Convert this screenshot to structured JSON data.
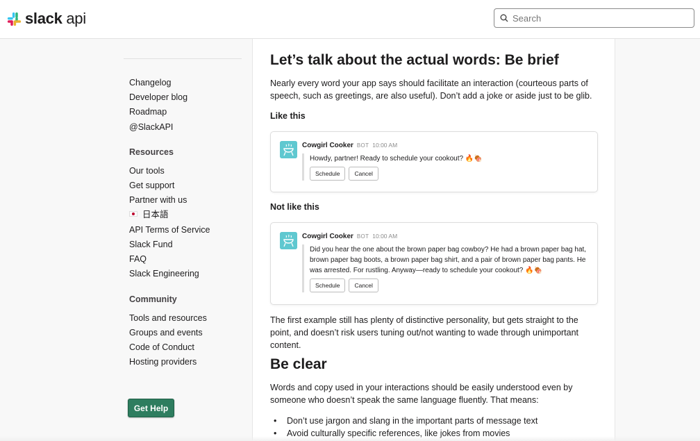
{
  "header": {
    "logo_bold": "slack",
    "logo_light": " api",
    "search_placeholder": "Search"
  },
  "sidebar": {
    "links_top": [
      "Changelog",
      "Developer blog",
      "Roadmap",
      "@SlackAPI"
    ],
    "resources_heading": "Resources",
    "resources": [
      "Our tools",
      "Get support",
      "Partner with us",
      "日本語",
      "API Terms of Service",
      "Slack Fund",
      "FAQ",
      "Slack Engineering"
    ],
    "community_heading": "Community",
    "community": [
      "Tools and resources",
      "Groups and events",
      "Code of Conduct",
      "Hosting providers"
    ],
    "get_help": "Get Help"
  },
  "main": {
    "heading1": "Let’s talk about the actual words: Be brief",
    "para1": "Nearly every word your app says should facilitate an interaction (courteous parts of speech, such as greetings, are also useful). Don’t add a joke or aside just to be glib.",
    "like_label": "Like this",
    "example1": {
      "name": "Cowgirl Cooker",
      "bot": "BOT",
      "time": "10:00 AM",
      "text": "Howdy, partner! Ready to schedule your cookout? 🔥🍖",
      "buttons": [
        "Schedule",
        "Cancel"
      ]
    },
    "notlike_label": "Not like this",
    "example2": {
      "name": "Cowgirl Cooker",
      "bot": "BOT",
      "time": "10:00 AM",
      "text": "Did you hear the one about the brown paper bag cowboy? He had a brown paper bag hat, brown paper bag boots, a brown paper bag shirt, and a pair of brown paper bag pants. He was arrested. For rustling. Anyway—ready to schedule your cookout? 🔥🍖",
      "buttons": [
        "Schedule",
        "Cancel"
      ]
    },
    "para2": "The first example still has plenty of distinctive personality, but gets straight to the point, and doesn’t risk users tuning out/not wanting to wade through unimportant content.",
    "heading2": "Be clear",
    "para3": "Words and copy used in your interactions should be easily understood even by someone who doesn’t speak the same language fluently. That means:",
    "bullets": [
      "Don’t use jargon and slang in the important parts of message text",
      "Avoid culturally specific references, like jokes from movies"
    ]
  },
  "colors": {
    "accent_green": "#2e7d5f",
    "avatar_teal": "#5fc8d0",
    "slack_blue": "#36c5f0",
    "slack_green": "#2eb67d",
    "slack_yellow": "#ecb22e",
    "slack_red": "#e01e5a"
  },
  "icons": [
    "slack-logo-icon",
    "search-icon",
    "japan-flag-icon",
    "cooker-avatar-icon"
  ]
}
